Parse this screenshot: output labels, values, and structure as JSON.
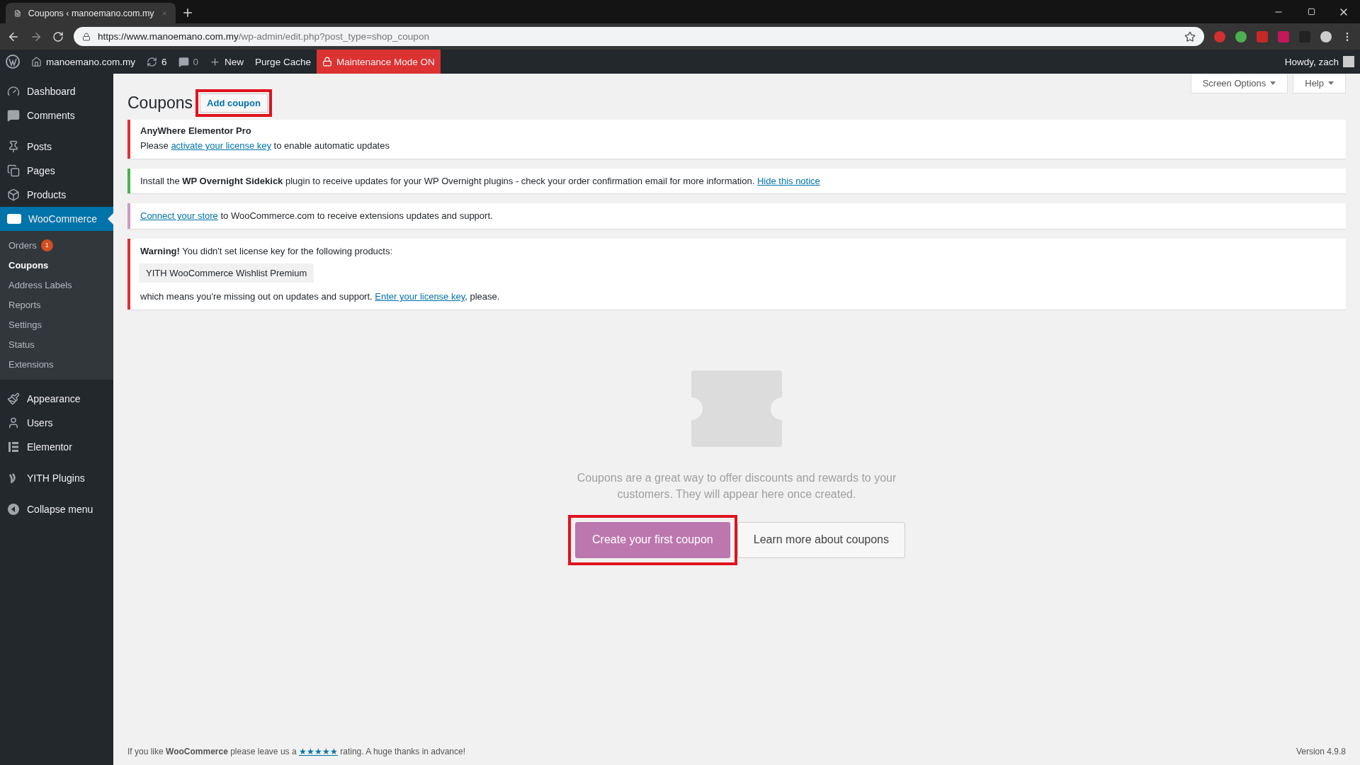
{
  "browser": {
    "tab_title": "Coupons ‹ manoemano.com.my",
    "url_host": "https://www.manoemano.com.my",
    "url_path": "/wp-admin/edit.php?post_type=shop_coupon"
  },
  "admin_bar": {
    "site": "manoemano.com.my",
    "updates": "6",
    "comments": "0",
    "new": "New",
    "purge": "Purge Cache",
    "maintenance": "Maintenance Mode ON",
    "greeting": "Howdy, zach"
  },
  "sidebar": {
    "items": [
      {
        "label": "Dashboard",
        "selected": false
      },
      {
        "label": "Comments",
        "selected": false
      },
      {
        "label": "Posts",
        "selected": false
      },
      {
        "label": "Pages",
        "selected": false
      },
      {
        "label": "Products",
        "selected": false
      },
      {
        "label": "WooCommerce",
        "selected": true,
        "children": [
          {
            "label": "Orders",
            "badge": "1",
            "selected": false
          },
          {
            "label": "Coupons",
            "selected": true
          },
          {
            "label": "Address Labels",
            "selected": false
          },
          {
            "label": "Reports",
            "selected": false
          },
          {
            "label": "Settings",
            "selected": false
          },
          {
            "label": "Status",
            "selected": false
          },
          {
            "label": "Extensions",
            "selected": false
          }
        ]
      },
      {
        "label": "Appearance",
        "selected": false
      },
      {
        "label": "Users",
        "selected": false
      },
      {
        "label": "Elementor",
        "selected": false
      },
      {
        "label": "YITH Plugins",
        "selected": false
      },
      {
        "label": "Collapse menu",
        "selected": false
      }
    ]
  },
  "screen_tabs": [
    "Screen Options",
    "Help"
  ],
  "heading": {
    "title": "Coupons",
    "add_button": "Add coupon",
    "add_highlighted": true
  },
  "notices": [
    {
      "color": "#dc3232",
      "title": "AnyWhere Elementor Pro",
      "lines": [
        [
          {
            "kind": "text",
            "text": "Please "
          },
          {
            "kind": "link",
            "text": "activate your license key"
          },
          {
            "kind": "text",
            "text": " to enable automatic updates"
          }
        ]
      ]
    },
    {
      "color": "#46b450",
      "lines": [
        [
          {
            "kind": "text",
            "text": "Install the "
          },
          {
            "kind": "bold",
            "text": "WP Overnight Sidekick"
          },
          {
            "kind": "text",
            "text": " plugin to receive updates for your WP Overnight plugins - check your order confirmation email for more information. "
          },
          {
            "kind": "link",
            "text": "Hide this notice"
          }
        ]
      ]
    },
    {
      "color": "#cc99c2",
      "lines": [
        [
          {
            "kind": "link",
            "text": "Connect your store"
          },
          {
            "kind": "text",
            "text": " to WooCommerce.com to receive extensions updates and support."
          }
        ]
      ]
    },
    {
      "color": "#dc3232",
      "lines": [
        [
          {
            "kind": "bold",
            "text": "Warning!"
          },
          {
            "kind": "text",
            "text": " You didn't set license key for the following products:"
          }
        ]
      ],
      "tag": "YITH WooCommerce Wishlist Premium",
      "after": [
        [
          {
            "kind": "text",
            "text": "which means you're missing out on updates and support. "
          },
          {
            "kind": "link",
            "text": "Enter your license key"
          },
          {
            "kind": "text",
            "text": ", please."
          }
        ]
      ]
    }
  ],
  "empty_state": {
    "message": "Coupons are a great way to offer discounts and rewards to your customers. They will appear here once created.",
    "primary": "Create your first coupon",
    "primary_highlighted": true,
    "secondary": "Learn more about coupons"
  },
  "footer": {
    "thanks": [
      {
        "kind": "text",
        "text": "If you like "
      },
      {
        "kind": "bold",
        "text": "WooCommerce"
      },
      {
        "kind": "text",
        "text": " please leave us a "
      },
      {
        "kind": "link",
        "text": "★★★★★"
      },
      {
        "kind": "text",
        "text": " rating. A huge thanks in advance!"
      }
    ],
    "version": "Version 4.9.8"
  }
}
